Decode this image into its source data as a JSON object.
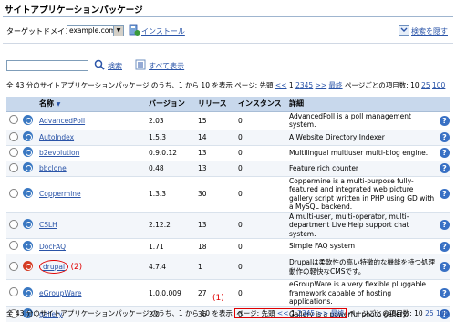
{
  "page": {
    "title": "サイトアプリケーションパッケージ"
  },
  "domain_row": {
    "label": "ターゲットドメイン:",
    "selected": "example.com",
    "install_label": "インストール",
    "search_toggle_label": "検索を隠す"
  },
  "search": {
    "value": "",
    "search_label": "検索",
    "show_all_label": "すべて表示"
  },
  "pager": {
    "summary_prefix": "全 43 分のサイトアプリケーションパッケージ のうち、1 から 10 を表示",
    "page_label": "ページ: 先頭",
    "prev": "<<",
    "current": "1",
    "pages": [
      "2",
      "3",
      "4",
      "5"
    ],
    "next": ">>",
    "last": "最終",
    "per_page_label": "ページごとの項目数:",
    "per_page_options": [
      "10",
      "25",
      "100"
    ],
    "per_page_selected": "10"
  },
  "table": {
    "columns": [
      "名称",
      "バージョン",
      "リリース",
      "インスタンス",
      "詳細"
    ],
    "rows": [
      {
        "name": "AdvancedPoll",
        "version": "2.03",
        "release": "15",
        "instances": "0",
        "detail": "AdvancedPoll is a poll management system."
      },
      {
        "name": "AutoIndex",
        "version": "1.5.3",
        "release": "14",
        "instances": "0",
        "detail": "A Website Directory Indexer"
      },
      {
        "name": "b2evolution",
        "version": "0.9.0.12",
        "release": "13",
        "instances": "0",
        "detail": "Multilingual multiuser multi-blog engine."
      },
      {
        "name": "bbclone",
        "version": "0.48",
        "release": "13",
        "instances": "0",
        "detail": "Feature rich counter"
      },
      {
        "name": "Coppermine",
        "version": "1.3.3",
        "release": "30",
        "instances": "0",
        "detail": "Coppermine is a multi-purpose fully-featured and integrated web picture gallery script written in PHP using GD with a MySQL backend."
      },
      {
        "name": "CSLH",
        "version": "2.12.2",
        "release": "13",
        "instances": "0",
        "detail": "A multi-user, multi-operator, multi-department Live Help support chat system."
      },
      {
        "name": "DocFAQ",
        "version": "1.71",
        "release": "18",
        "instances": "0",
        "detail": "Simple FAQ system"
      },
      {
        "name": "drupal",
        "version": "4.7.4",
        "release": "1",
        "instances": "0",
        "detail": "Drupalは柔軟性の高い特徴的な機能を持つ処理動作の軽快なCMSです。"
      },
      {
        "name": "eGroupWare",
        "version": "1.0.0.009",
        "release": "27",
        "instances": "0",
        "detail": "eGroupWare is a very flexible pluggable framework capable of hosting applications."
      },
      {
        "name": "gallery",
        "version": "2.0",
        "release": "36",
        "instances": "0",
        "detail": "Gallery is a powerful photo gallery."
      }
    ]
  },
  "annotations": {
    "one": "(1)",
    "two": "(2)"
  }
}
